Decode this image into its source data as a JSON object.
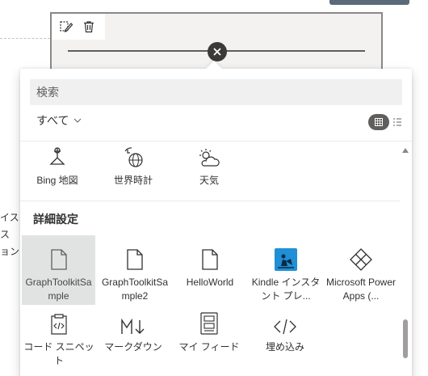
{
  "side_text": [
    "イス",
    "ス",
    "ョン"
  ],
  "toolbar": {
    "edit_icon": "edit-webpart-icon",
    "delete_icon": "trash-icon"
  },
  "add_button_icon": "close-x-icon",
  "search": {
    "placeholder": "検索",
    "value": ""
  },
  "filter": {
    "label": "すべて",
    "icon": "chevron-down-icon"
  },
  "view_toggle": {
    "grid_icon": "grid-view-icon",
    "list_icon": "list-view-icon"
  },
  "row1": [
    {
      "label": "Bing 地図",
      "icon": "map-pin-icon"
    },
    {
      "label": "世界時計",
      "icon": "world-clock-icon"
    },
    {
      "label": "天気",
      "icon": "weather-icon"
    }
  ],
  "section_title": "詳細設定",
  "row2": [
    {
      "label": "GraphToolkitSample",
      "icon": "document-icon",
      "selected": true
    },
    {
      "label": "GraphToolkitSample2",
      "icon": "document-icon",
      "selected": false
    },
    {
      "label": "HelloWorld",
      "icon": "document-icon",
      "selected": false
    },
    {
      "label": "Kindle インスタント プレ...",
      "icon": "kindle-icon",
      "selected": false
    },
    {
      "label": "Microsoft PowerApps (...",
      "icon": "powerapps-icon",
      "selected": false
    }
  ],
  "row3": [
    {
      "label": "コード スニペット",
      "icon": "code-snippet-icon"
    },
    {
      "label": "マークダウン",
      "icon": "markdown-icon"
    },
    {
      "label": "マイ フィード",
      "icon": "my-feed-icon"
    },
    {
      "label": "埋め込み",
      "icon": "embed-icon"
    }
  ],
  "colors": {
    "accent_dark": "#605e5c",
    "selected_bg": "#e1e3e3",
    "kindle_blue": "#1f8fd6"
  }
}
